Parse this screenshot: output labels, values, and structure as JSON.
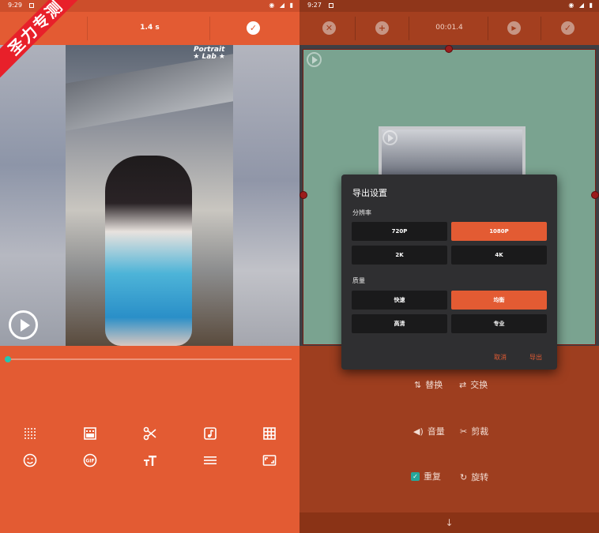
{
  "left": {
    "status": {
      "time": "9:29"
    },
    "toolbar": {
      "duration": "1.4 s"
    },
    "watermark": {
      "line1": "Portrait",
      "line2": "★ Lab ★"
    },
    "ribbon": "圣力专测",
    "tools_row1": [
      "dots-grid-icon",
      "gradient-icon",
      "scissors-icon",
      "music-note-icon",
      "grid-icon"
    ],
    "tools_row2": [
      "emoji-icon",
      "gif-icon",
      "text-size-icon",
      "lines-icon",
      "aspect-ratio-icon"
    ],
    "progress": 0
  },
  "right": {
    "status": {
      "time": "9:27"
    },
    "toolbar": {
      "time": "00:01.4"
    },
    "dialog": {
      "title": "导出设置",
      "resolution_label": "分辨率",
      "resolutions": [
        "720P",
        "1080P",
        "2K",
        "4K"
      ],
      "selected_resolution": "1080P",
      "quality_label": "质量",
      "qualities": [
        "快速",
        "均衡",
        "高清",
        "专业"
      ],
      "selected_quality": "均衡",
      "cancel": "取消",
      "export": "导出"
    },
    "controls": {
      "replace": "替换",
      "swap": "交换",
      "volume": "音量",
      "crop": "剪裁",
      "repeat": "重复",
      "rotate": "旋转"
    }
  },
  "colors": {
    "accent": "#e35b33",
    "dark_accent": "#9e3e1f",
    "mint": "#7aa390",
    "dialog_bg": "#2f2f31",
    "teal": "#26c6b0"
  }
}
